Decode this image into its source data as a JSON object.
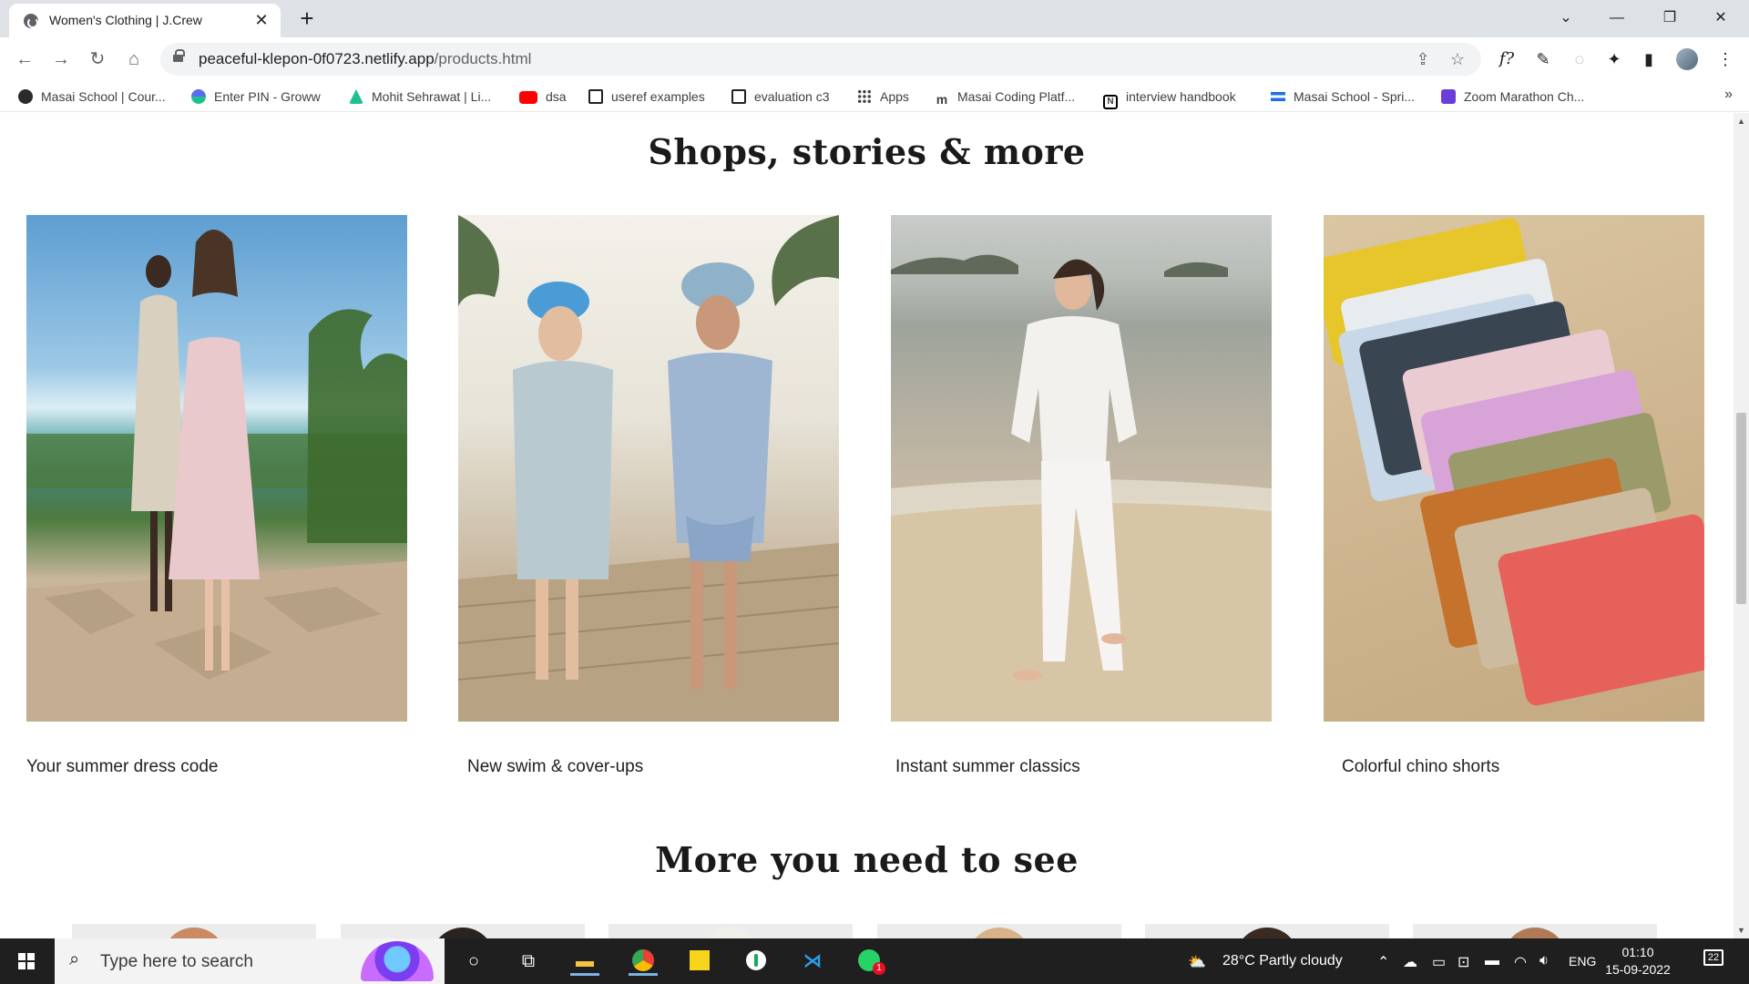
{
  "browser": {
    "tab_title": "Women's Clothing | J.Crew",
    "tab_close": "✕",
    "new_tab": "+",
    "url_host": "peaceful-klepon-0f0723.netlify.app",
    "url_path": "/products.html",
    "window_controls": [
      "⌄",
      "—",
      "❐",
      "✕"
    ],
    "nav": {
      "back": "←",
      "forward": "→",
      "reload": "↻",
      "home": "⌂"
    },
    "toolbar_icons": [
      "f?",
      "✎",
      "◌",
      "✦",
      "▮",
      "⋮"
    ]
  },
  "bookmarks": {
    "items": [
      {
        "label": "Masai School | Cour...",
        "color": "#2b2b2b"
      },
      {
        "label": "Enter PIN - Groww",
        "color": "#5a6cf0"
      },
      {
        "label": "Mohit Sehrawat | Li...",
        "color": "#1fbf8f"
      },
      {
        "label": "dsa",
        "color": "#ff0000"
      },
      {
        "label": "useref examples",
        "color": "#ffffff"
      },
      {
        "label": "evaluation c3",
        "color": "#ffffff"
      },
      {
        "label": "Apps",
        "color": "#3c4043"
      },
      {
        "label": "Masai Coding Platf...",
        "color": "#ffffff"
      },
      {
        "label": "interview handbook",
        "color": "#000000"
      },
      {
        "label": "Masai School - Spri...",
        "color": "#1f6fe5"
      },
      {
        "label": "Zoom Marathon Ch...",
        "color": "#6a3ed8"
      }
    ],
    "more": "»"
  },
  "page": {
    "heading_shops": "Shops, stories & more",
    "cards": [
      {
        "caption": "Your summer dress code"
      },
      {
        "caption": "New swim & cover-ups"
      },
      {
        "caption": "Instant summer classics"
      },
      {
        "caption": "Colorful chino shorts"
      }
    ],
    "heading_more": "More you need to see"
  },
  "taskbar": {
    "search_placeholder": "Type here to search",
    "weather": "28°C  Partly cloudy",
    "language": "ENG",
    "time": "01:10",
    "date": "15-09-2022",
    "notifications": "22"
  }
}
